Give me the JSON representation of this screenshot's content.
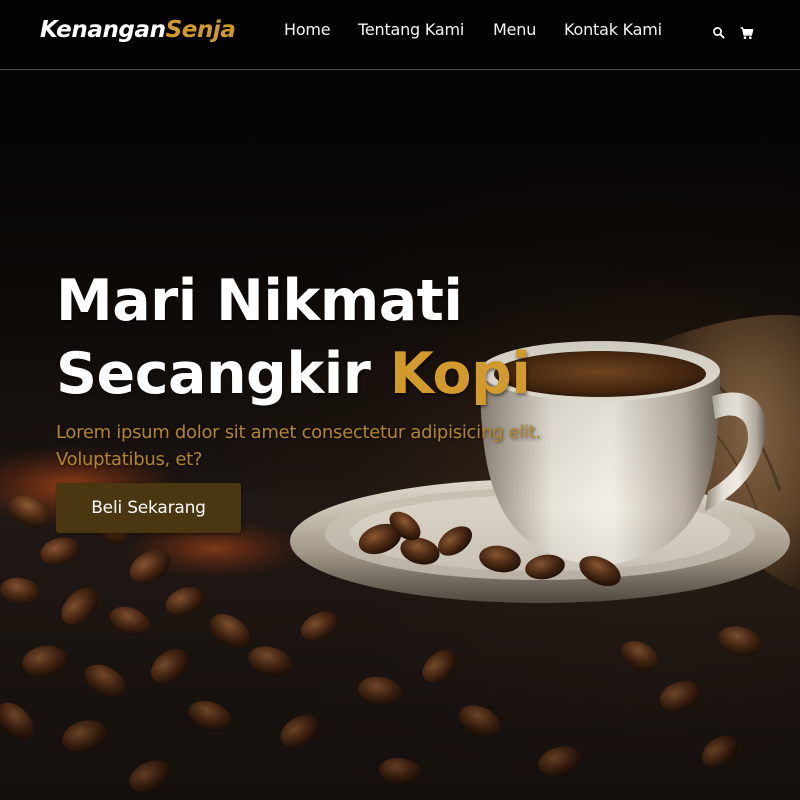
{
  "brand": {
    "name_part1": "Kenangan",
    "name_part2": "Senja"
  },
  "nav": {
    "links": [
      {
        "label": "Home"
      },
      {
        "label": "Tentang Kami"
      },
      {
        "label": "Menu"
      },
      {
        "label": "Kontak Kami"
      }
    ],
    "icons": [
      "search-icon",
      "shopping-cart-icon"
    ]
  },
  "hero": {
    "title_line1": "Mari Nikmati",
    "title_line2_prefix": "Secangkir ",
    "title_highlight": "Kopi",
    "description": "Lorem ipsum dolor sit amet consectetur adipisicing elit. Voluptatibus, et?",
    "cta_label": "Beli Sekarang"
  },
  "colors": {
    "accent": "#d29a2c",
    "navbar_bg": "#020202",
    "cta_bg": "#4a3610",
    "text_primary": "#ffffff"
  }
}
